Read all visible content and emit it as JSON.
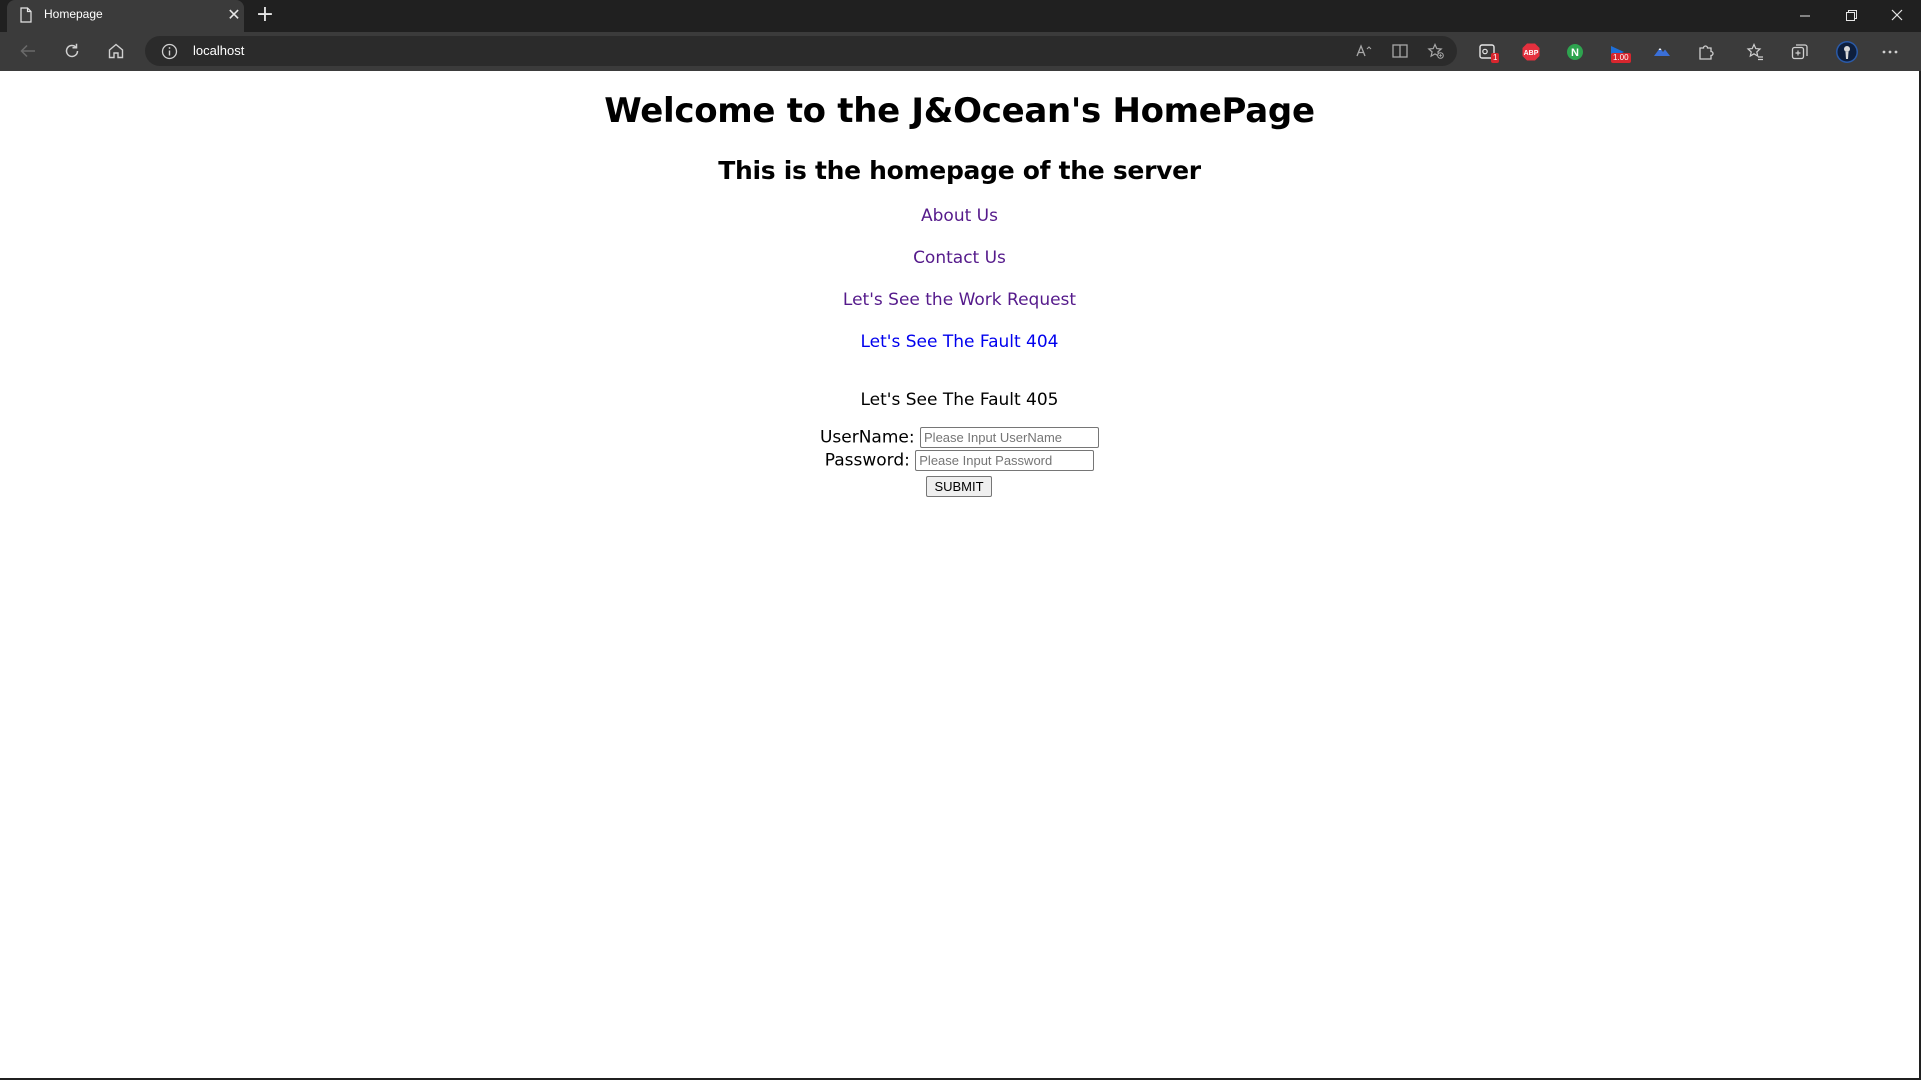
{
  "browser": {
    "tab_title": "Homepage",
    "tab_close_glyph": "✕",
    "new_tab_glyph": "+",
    "url": "localhost",
    "extensions": [
      {
        "name": "screen-capture-extension",
        "badge": "1",
        "color": "#d7262e"
      },
      {
        "name": "adblock-plus-extension",
        "label": "ABP",
        "color": "#e4303e"
      },
      {
        "name": "n-extension",
        "label": "N",
        "color": "#2ea44f"
      },
      {
        "name": "speed-extension",
        "badge": "1.00",
        "color": "#1e6fd9"
      },
      {
        "name": "mountain-extension",
        "color": "#3a6fd8"
      }
    ]
  },
  "page": {
    "heading": "Welcome to the J&Ocean's HomePage",
    "subheading": "This is the homepage of the server",
    "links": [
      {
        "label": "About Us",
        "visited": true
      },
      {
        "label": "Contact Us",
        "visited": true
      },
      {
        "label": "Let's See the Work Request",
        "visited": true
      },
      {
        "label": "Let's See The Fault 404",
        "visited": false
      }
    ],
    "plain_text": "Let's See The Fault 405",
    "form": {
      "username_label": "UserName:",
      "username_placeholder": "Please Input UserName",
      "password_label": "Password:",
      "password_placeholder": "Please Input Password",
      "submit_label": "SUBMIT"
    }
  },
  "colors": {
    "visited_link": "#551a8b",
    "unvisited_link": "#0000ee",
    "browser_frame": "#202020",
    "toolbar": "#3b3b3b"
  }
}
